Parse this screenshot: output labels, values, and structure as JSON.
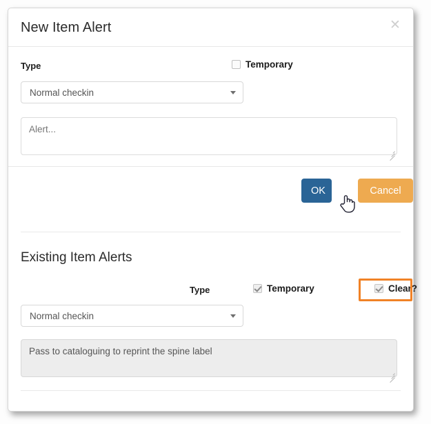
{
  "dialog": {
    "title": "New Item Alert",
    "close_icon": "close-icon"
  },
  "new_alert": {
    "type_label": "Type",
    "temporary_label": "Temporary",
    "temporary_checked": false,
    "type_value": "Normal checkin",
    "alert_placeholder": "Alert...",
    "alert_value": ""
  },
  "footer": {
    "ok_label": "OK",
    "cancel_label": "Cancel"
  },
  "existing": {
    "heading": "Existing Item Alerts",
    "type_label": "Type",
    "temporary_label": "Temporary",
    "temporary_checked": true,
    "clear_label": "Clear?",
    "clear_checked": true,
    "type_value": "Normal checkin",
    "note_value": "Pass to cataloguing to reprint the spine label"
  },
  "colors": {
    "ok_button": "#2a6496",
    "cancel_button": "#eeaa50",
    "highlight": "#f08226",
    "title_text": "#2b2b2b",
    "disabled_field": "#ededed"
  },
  "cursor": {
    "icon": "hand-pointer-cursor"
  }
}
